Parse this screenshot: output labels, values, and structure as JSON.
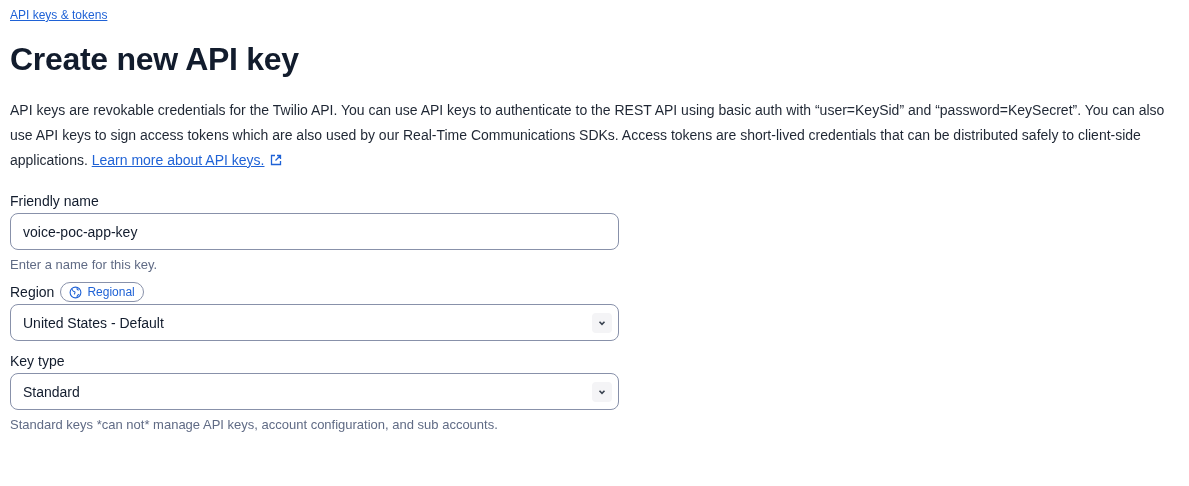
{
  "breadcrumb": "API keys & tokens",
  "title": "Create new API key",
  "description": {
    "text": "API keys are revokable credentials for the Twilio API. You can use API keys to authenticate to the REST API using basic auth with “user=KeySid” and “password=KeySecret”. You can also use API keys to sign access tokens which are also used by our Real-Time Communications SDKs. Access tokens are short-lived credentials that can be distributed safely to client-side applications.",
    "link": "Learn more about API keys."
  },
  "fields": [
    {
      "kind": "text",
      "label": "Friendly name",
      "value": "voice-poc-app-key",
      "help": "Enter a name for this key."
    },
    {
      "kind": "select",
      "label": "Region",
      "badge": "Regional",
      "value": "United States - Default"
    },
    {
      "kind": "select",
      "label": "Key type",
      "value": "Standard",
      "help": "Standard keys *can not* manage API keys, account configuration, and sub accounts."
    }
  ]
}
